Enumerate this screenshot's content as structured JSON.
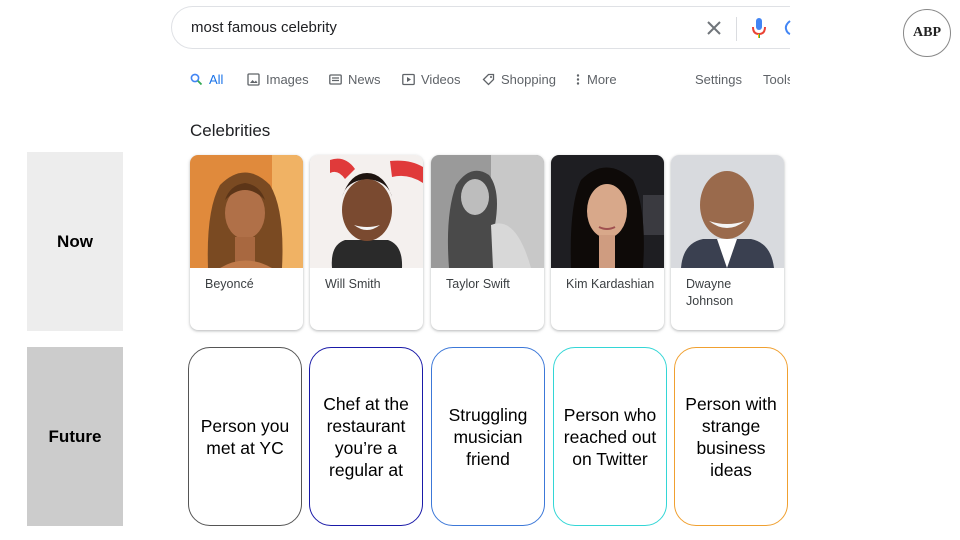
{
  "search": {
    "query": "most famous celebrity"
  },
  "tabs": [
    {
      "label": "All",
      "icon": "search-icon",
      "active": true
    },
    {
      "label": "Images",
      "icon": "image-icon"
    },
    {
      "label": "News",
      "icon": "news-icon"
    },
    {
      "label": "Videos",
      "icon": "video-icon"
    },
    {
      "label": "Shopping",
      "icon": "tag-icon"
    },
    {
      "label": "More",
      "icon": "more-vert-icon"
    }
  ],
  "tools": {
    "settings": "Settings",
    "tools": "Tools"
  },
  "celebrities": {
    "title": "Celebrities",
    "items": [
      {
        "name": "Beyoncé"
      },
      {
        "name": "Will Smith"
      },
      {
        "name": "Taylor Swift"
      },
      {
        "name": "Kim Kardashian"
      },
      {
        "name": "Dwayne Johnson"
      }
    ]
  },
  "rows": {
    "now": "Now",
    "future": "Future"
  },
  "future_items": [
    {
      "text": "Person you met at YC",
      "color": "#555555"
    },
    {
      "text": "Chef at the restaurant you’re a regular at",
      "color": "#1a1aa8"
    },
    {
      "text": "Struggling musician friend",
      "color": "#3c78d8"
    },
    {
      "text": "Person who reached out on Twitter",
      "color": "#33d6d6"
    },
    {
      "text": "Person with strange business ideas",
      "color": "#f0a030"
    }
  ],
  "logo": {
    "text": "ABP"
  },
  "colors": {
    "accent": "#1a73e8",
    "mic_blue": "#4285f4",
    "mic_red": "#ea4335"
  }
}
